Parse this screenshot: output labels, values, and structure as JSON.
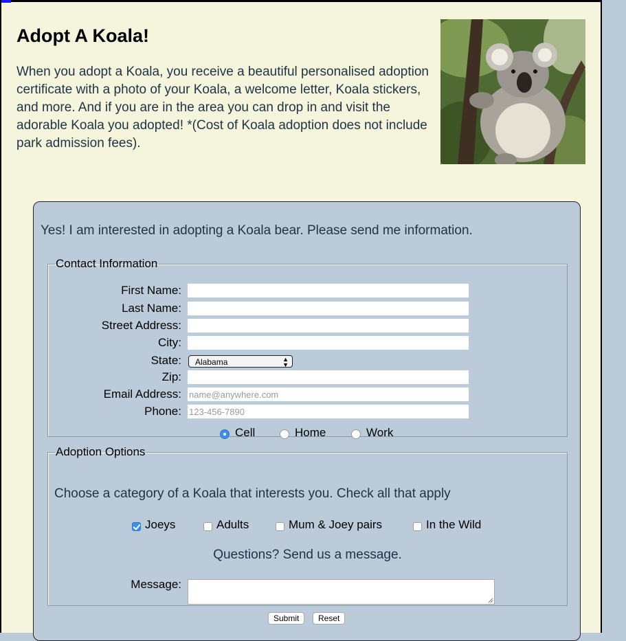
{
  "page": {
    "title": "Adopt A Koala!",
    "intro": "When you adopt a Koala, you receive a beautiful personalised adoption certificate with a photo of your Koala, a welcome letter, Koala stickers, and more. And if you are in the area you can drop in and visit the adorable Koala you adopted! *(Cost of Koala adoption does not include park admission fees)."
  },
  "form": {
    "interest_text": "Yes! I am interested in adopting a Koala bear. Please send me information.",
    "contact": {
      "legend": "Contact Information",
      "first_name_label": "First Name:",
      "last_name_label": "Last Name:",
      "street_label": "Street Address:",
      "city_label": "City:",
      "state_label": "State:",
      "state_value": "Alabama",
      "zip_label": "Zip:",
      "email_label": "Email Address:",
      "email_placeholder": "name@anywhere.com",
      "phone_label": "Phone:",
      "phone_placeholder": "123-456-7890",
      "phone_types": [
        {
          "label": "Cell",
          "checked": true
        },
        {
          "label": "Home",
          "checked": false
        },
        {
          "label": "Work",
          "checked": false
        }
      ]
    },
    "options": {
      "legend": "Adoption Options",
      "choose_text": "Choose a category of a Koala that interests you. Check all that apply",
      "categories": [
        {
          "label": "Joeys",
          "checked": true
        },
        {
          "label": "Adults",
          "checked": false
        },
        {
          "label": "Mum & Joey pairs",
          "checked": false
        },
        {
          "label": "In the Wild",
          "checked": false
        }
      ],
      "questions_text": "Questions? Send us a message.",
      "message_label": "Message:"
    },
    "submit_label": "Submit",
    "reset_label": "Reset"
  },
  "colors": {
    "page_background": "#f5f4dc",
    "form_background": "#bccbda",
    "text_blue": "#1f3344",
    "control_accent": "#3d8ee8"
  }
}
